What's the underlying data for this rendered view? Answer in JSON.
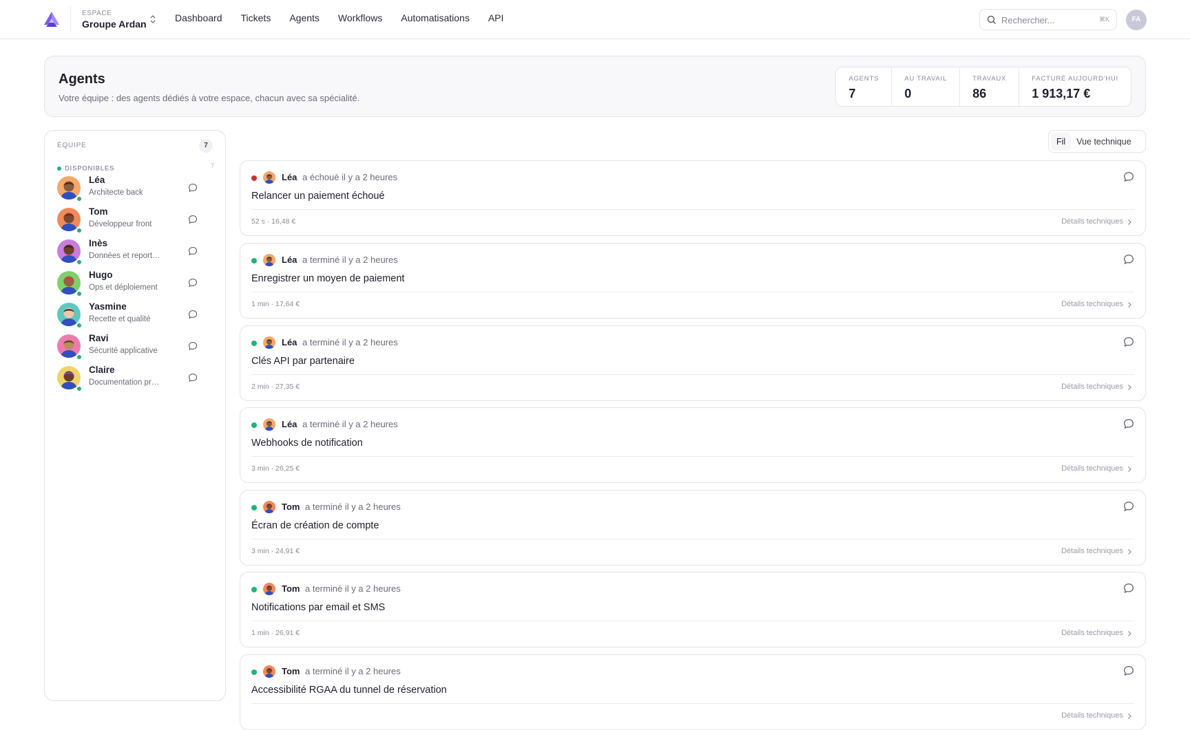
{
  "topbar": {
    "workspace_label": "ESPACE",
    "workspace_name": "Groupe Ardan",
    "nav": [
      "Dashboard",
      "Tickets",
      "Agents",
      "Workflows",
      "Automatisations",
      "API"
    ],
    "search_placeholder": "Rechercher...",
    "search_shortcut": "⌘K",
    "user_initials": "FA",
    "accent": "#7b5cf0"
  },
  "header": {
    "title": "Agents",
    "subtitle": "Votre équipe : des agents dédiés à votre espace, chacun avec sa spécialité.",
    "stats": [
      {
        "label": "AGENTS",
        "value": "7"
      },
      {
        "label": "AU TRAVAIL",
        "value": "0"
      },
      {
        "label": "TRAVAUX",
        "value": "86"
      },
      {
        "label": "FACTURÉ AUJOURD'HUI",
        "value": "1 913,17 €"
      }
    ]
  },
  "sidebar": {
    "title": "ÉQUIPE",
    "count": "7",
    "group_label": "DISPONIBLES",
    "group_count": "7",
    "status_color": "#22b07d",
    "agents": [
      {
        "name": "Léa",
        "role": "Architecte back",
        "avatar_bg": "#f4a86a",
        "skin": "#8a5a3c",
        "hair": "#3b2a20"
      },
      {
        "name": "Tom",
        "role": "Développeur front",
        "avatar_bg": "#f08a5a",
        "skin": "#7a4a30",
        "hair": "#8b1e2a"
      },
      {
        "name": "Inès",
        "role": "Données et reporting",
        "avatar_bg": "#c77ddb",
        "skin": "#6e4028",
        "hair": "#3a2418"
      },
      {
        "name": "Hugo",
        "role": "Ops et déploiement",
        "avatar_bg": "#7fcf6a",
        "skin": "#9a6040",
        "hair": "#d23a4a"
      },
      {
        "name": "Yasmine",
        "role": "Recette et qualité",
        "avatar_bg": "#5ec8c0",
        "skin": "#f1c7a8",
        "hair": "#3a2a22"
      },
      {
        "name": "Ravi",
        "role": "Sécurité applicative",
        "avatar_bg": "#ee7ab0",
        "skin": "#c08a60",
        "hair": "#5a3a28"
      },
      {
        "name": "Claire",
        "role": "Documentation produit",
        "avatar_bg": "#f0d46a",
        "skin": "#6a3e28",
        "hair": "#7a48c8"
      }
    ]
  },
  "view_toggle": {
    "options": [
      "Fil",
      "Vue technique"
    ],
    "active": "Fil"
  },
  "feed": {
    "details_label": "Détails techniques",
    "items": [
      {
        "agent": "Léa",
        "action": "a échoué il y a 2 heures",
        "status": "failed",
        "status_color": "#d62b2b",
        "title": "Relancer un paiement échoué",
        "meta": "52 s · 16,48 €"
      },
      {
        "agent": "Léa",
        "action": "a terminé il y a 2 heures",
        "status": "done",
        "status_color": "#22b07d",
        "title": "Enregistrer un moyen de paiement",
        "meta": "1 min · 17,64 €"
      },
      {
        "agent": "Léa",
        "action": "a terminé il y a 2 heures",
        "status": "done",
        "status_color": "#22b07d",
        "title": "Clés API par partenaire",
        "meta": "2 min · 27,35 €"
      },
      {
        "agent": "Léa",
        "action": "a terminé il y a 2 heures",
        "status": "done",
        "status_color": "#22b07d",
        "title": "Webhooks de notification",
        "meta": "3 min · 26,25 €"
      },
      {
        "agent": "Tom",
        "action": "a terminé il y a 2 heures",
        "status": "done",
        "status_color": "#22b07d",
        "title": "Écran de création de compte",
        "meta": "3 min · 24,91 €"
      },
      {
        "agent": "Tom",
        "action": "a terminé il y a 2 heures",
        "status": "done",
        "status_color": "#22b07d",
        "title": "Notifications par email et SMS",
        "meta": "1 min · 26,91 €"
      },
      {
        "agent": "Tom",
        "action": "a terminé il y a 2 heures",
        "status": "done",
        "status_color": "#22b07d",
        "title": "Accessibilité RGAA du tunnel de réservation",
        "meta": ""
      }
    ]
  }
}
